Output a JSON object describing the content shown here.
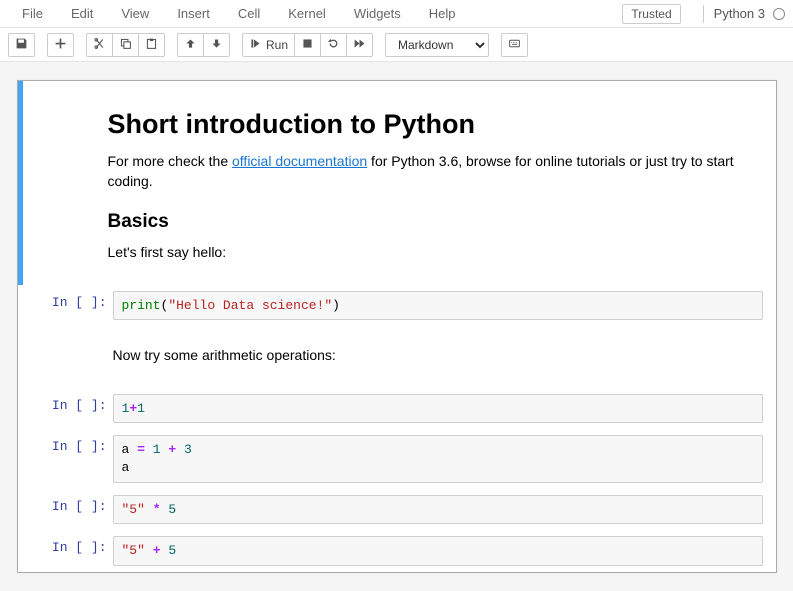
{
  "menubar": {
    "items": [
      "File",
      "Edit",
      "View",
      "Insert",
      "Cell",
      "Kernel",
      "Widgets",
      "Help"
    ],
    "trusted": "Trusted",
    "kernel_name": "Python 3"
  },
  "toolbar": {
    "run_label": "Run",
    "celltype_selected": "Markdown"
  },
  "notebook": {
    "md1": {
      "h1": "Short introduction to Python",
      "p1_a": "For more check the ",
      "p1_link": "official documentation",
      "p1_b": " for Python 3.6, browse for online tutorials or just try to start coding.",
      "h2": "Basics",
      "p2": "Let's first say hello:"
    },
    "md2": {
      "p1": "Now try some arithmetic operations:"
    },
    "prompts": {
      "in_empty": "In [ ]:"
    },
    "code1": {
      "t1": "print",
      "t2": "(",
      "t3": "\"Hello Data science!\"",
      "t4": ")"
    },
    "code2": {
      "t1": "1",
      "t2": "+",
      "t3": "1"
    },
    "code3": {
      "t1": "a",
      "t2": " = ",
      "t3": "1",
      "t4": " + ",
      "t5": "3",
      "t6": "\na"
    },
    "code4": {
      "t1": "\"5\"",
      "t2": " * ",
      "t3": "5"
    },
    "code5": {
      "t1": "\"5\"",
      "t2": " + ",
      "t3": "5"
    }
  }
}
